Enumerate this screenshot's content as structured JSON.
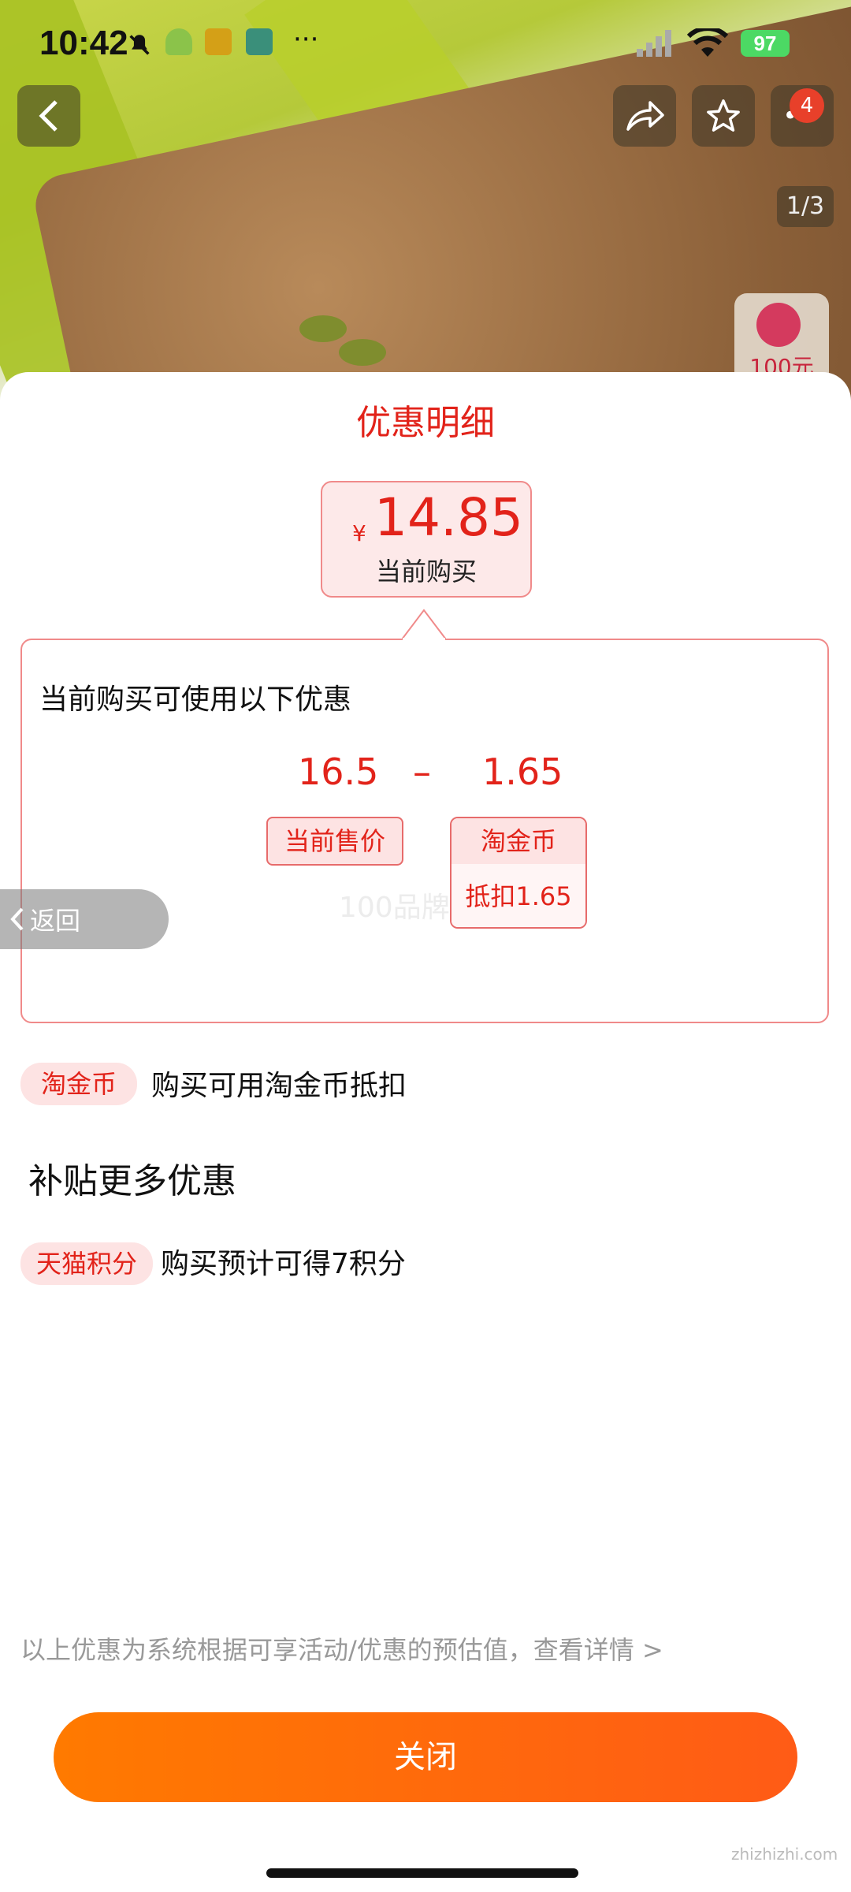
{
  "status_bar": {
    "time": "10:42",
    "battery": "97"
  },
  "hero": {
    "pager": "1/3",
    "badge_count": "4",
    "float_card_text": "100元"
  },
  "sheet": {
    "title": "优惠明细",
    "price": {
      "currency": "¥",
      "amount": "14.85",
      "label": "当前购买"
    },
    "detail": {
      "title": "当前购买可使用以下优惠",
      "original_price": "16.5",
      "operator": "–",
      "discount": "1.65",
      "original_price_label": "当前售价",
      "discount_label_top": "淘金币",
      "discount_label_bottom": "抵扣1.65",
      "watermark": "100品牌"
    },
    "rows": [
      {
        "tag": "淘金币",
        "text": "购买可用淘金币抵扣"
      }
    ],
    "section_title": "补贴更多优惠",
    "more_rows": [
      {
        "tag": "天猫积分",
        "text": "购买预计可得7积分"
      }
    ],
    "back_label": "返回",
    "footer_note": "以上优惠为系统根据可享活动/优惠的预估值，查看详情 >",
    "close_label": "关闭"
  },
  "site_mark": "zhizhizhi.com",
  "colors": {
    "accent_red": "#e2231a",
    "button_orange": "#ff6a0a"
  }
}
